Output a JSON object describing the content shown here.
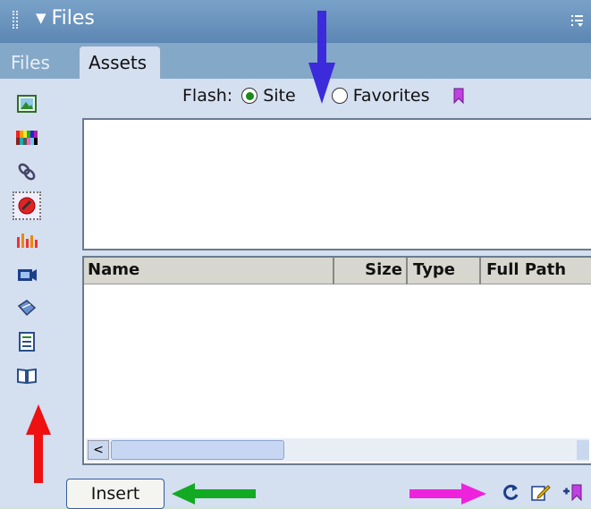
{
  "window": {
    "title": "Files"
  },
  "tabs": [
    {
      "label": "Files"
    },
    {
      "label": "Assets"
    }
  ],
  "assets": {
    "category_label": "Flash:",
    "scope_options": [
      {
        "label": "Site",
        "selected": true
      },
      {
        "label": "Favorites",
        "selected": false
      }
    ],
    "columns": [
      {
        "label": "Name"
      },
      {
        "label": "Size"
      },
      {
        "label": "Type"
      },
      {
        "label": "Full Path"
      }
    ],
    "insert_label": "Insert"
  },
  "sidebar_icons": [
    "images-icon",
    "colors-icon",
    "urls-icon",
    "flash-icon",
    "shockwave-icon",
    "movies-icon",
    "scripts-icon",
    "templates-icon",
    "library-icon"
  ],
  "colors": {
    "accent": "#355e9c",
    "annotation_blue": "#3b2bdb",
    "annotation_red": "#ee1111",
    "annotation_green": "#11aa22",
    "annotation_magenta": "#ee22dd"
  }
}
